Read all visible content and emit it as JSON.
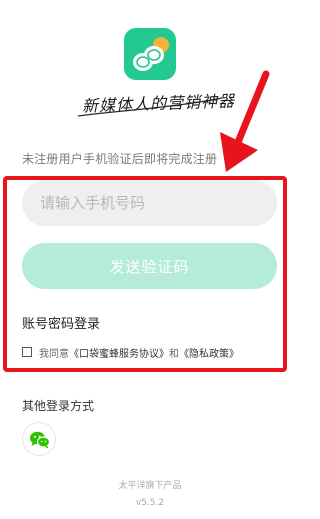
{
  "logo": {
    "icon": "bee-logo-icon",
    "color": "#23c98e"
  },
  "slogan": "新媒体人的营销神器",
  "hint": "未注册用户手机验证后即将完成注册",
  "phone": {
    "placeholder": "请输入手机号码",
    "value": ""
  },
  "send_code_label": "发送验证码",
  "password_login_label": "账号密码登录",
  "agreement": {
    "checked": false,
    "prefix": "我同意",
    "service_terms": "《口袋蜜蜂服务协议》",
    "conjunction": "和",
    "privacy_policy": "《隐私政策》"
  },
  "other_login": {
    "title": "其他登录方式",
    "methods": [
      {
        "icon": "wechat-icon",
        "color": "#2dc100"
      }
    ]
  },
  "footer": {
    "company": "太平洋旗下产品",
    "version": "v5.5.2"
  },
  "colors": {
    "accent": "#23c98e",
    "button_disabled": "#b5ebd9",
    "annotation_red": "#e8141b"
  }
}
